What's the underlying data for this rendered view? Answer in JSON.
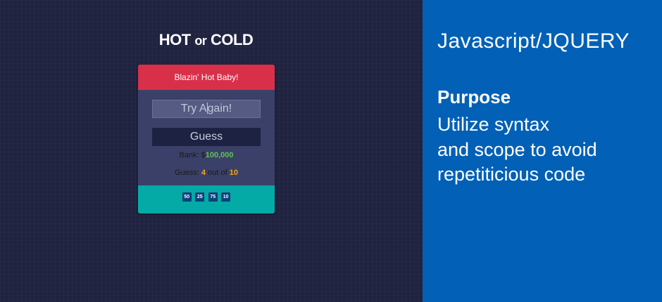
{
  "game": {
    "title_hot": "HOT",
    "title_or": "or",
    "title_cold": "COLD",
    "feedback": "Blazin' Hot Baby!",
    "input_text_a": "Try A",
    "input_text_b": "gain!",
    "guess_button": "Guess",
    "bank_label": "Bank: $",
    "bank_amount": "100,000",
    "guess_label": "Guess: ",
    "guess_current": "4",
    "guess_of": " out of ",
    "guess_total": "10",
    "chips": [
      "50",
      "25",
      "75",
      "10"
    ]
  },
  "info": {
    "headline": "Javascript/JQUERY",
    "purpose_title": "Purpose",
    "purpose_lines": [
      "Utilize syntax",
      "and scope to avoid",
      "repetiticious code"
    ]
  },
  "colors": {
    "left_bg": "#1f2340",
    "right_bg": "#0260b6",
    "feedback_bg": "#d9304a",
    "footer_bg": "#04aaa6",
    "bank_green": "#5cc456",
    "guess_orange": "#f5a418"
  }
}
